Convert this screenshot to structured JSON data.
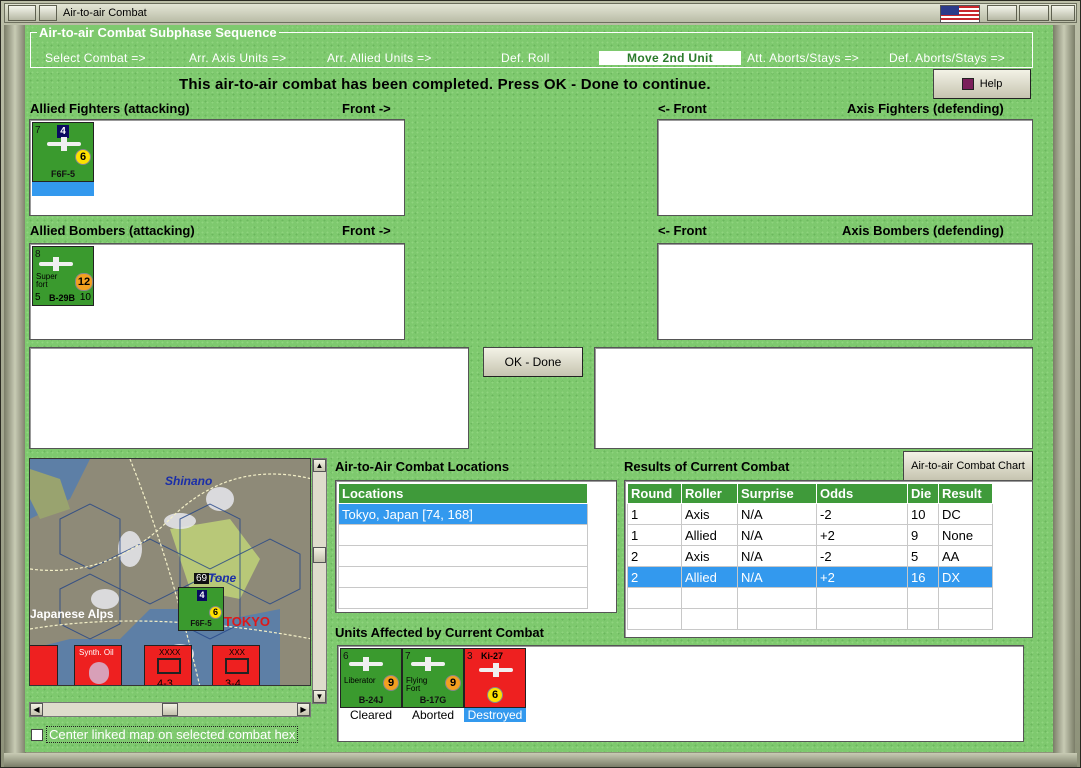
{
  "window": {
    "title": "Air-to-air Combat"
  },
  "phases": {
    "caption": "Air-to-air Combat Subphase Sequence",
    "steps": [
      "Select Combat =>",
      "Arr. Axis Units =>",
      "Arr. Allied Units =>",
      "Def. Roll",
      "Move 2nd Unit",
      "Att. Aborts/Stays =>",
      "Def. Aborts/Stays =>"
    ],
    "active_index": 4
  },
  "message": "This air-to-air combat has been completed.  Press OK - Done to continue.",
  "help_label": "Help",
  "ok_label": "OK - Done",
  "chart_button": "Air-to-air Combat Chart",
  "allied_fighters": {
    "label": "Allied Fighters (attacking)",
    "front": "Front ->"
  },
  "axis_fighters": {
    "label": "Axis Fighters (defending)",
    "front": "<- Front"
  },
  "allied_bombers": {
    "label": "Allied Bombers (attacking)",
    "front": "Front ->"
  },
  "axis_bombers": {
    "label": "Axis Bombers (defending)",
    "front": "<- Front"
  },
  "units": {
    "f6f": {
      "name": "F6F-5",
      "left": "7",
      "top": "4",
      "badge": "6"
    },
    "b29": {
      "name": "B-29B",
      "left": "8",
      "sub": "Super fort",
      "badge": "12",
      "bl": "5",
      "br": "10"
    }
  },
  "map": {
    "labels": [
      "Shinano",
      "Tone",
      "Japanese Alps",
      "TOKYO",
      "69",
      "Synth. Oil",
      "4-3",
      "3-4",
      "XXXX",
      "XXX"
    ]
  },
  "center_map_label": "Center linked map on selected combat hex",
  "locations": {
    "title": "Air-to-Air Combat Locations",
    "header": "Locations",
    "rows": [
      "Tokyo, Japan [74, 168]",
      "",
      "",
      "",
      ""
    ],
    "selected": 0
  },
  "results": {
    "title": "Results of Current Combat",
    "headers": [
      "Round",
      "Roller",
      "Surprise",
      "Odds",
      "Die",
      "Result"
    ],
    "rows": [
      [
        "1",
        "Axis",
        "N/A",
        "-2",
        "10",
        "DC"
      ],
      [
        "1",
        "Allied",
        "N/A",
        "+2",
        "9",
        "None"
      ],
      [
        "2",
        "Axis",
        "N/A",
        "-2",
        "5",
        "AA"
      ],
      [
        "2",
        "Allied",
        "N/A",
        "+2",
        "16",
        "DX"
      ],
      [
        "",
        "",
        "",
        "",
        "",
        ""
      ],
      [
        "",
        "",
        "",
        "",
        "",
        ""
      ]
    ],
    "selected": 3
  },
  "affected": {
    "title": "Units Affected by Current Combat",
    "units": [
      {
        "name": "B-24J",
        "sub": "Liberator",
        "badge": "9",
        "tl": "6",
        "status": "Cleared",
        "color": "green"
      },
      {
        "name": "B-17G",
        "sub": "Flying Fort",
        "badge": "9",
        "tl": "7",
        "status": "Aborted",
        "color": "green"
      },
      {
        "name": "Ki-27",
        "sub": "",
        "badge": "6",
        "tl": "3",
        "status": "Destroyed",
        "color": "red"
      }
    ]
  }
}
